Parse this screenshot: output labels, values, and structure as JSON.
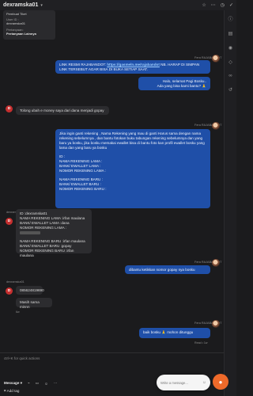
{
  "header": {
    "title": "dexramska01"
  },
  "info_card": {
    "top_text": "Pembuat Tiket",
    "user_id_label": "User ID :",
    "user_id_value": "dexramska01",
    "question_label": "Pertanyaan:",
    "question_value": "Pertanyaan Lainnya"
  },
  "messages": [
    {
      "id": "m1",
      "direction": "outgoing",
      "sender": "Fera RAJABANDOT",
      "text_before_link": "LINK RESMI RAJABANDOT: ",
      "link": "https://gasmeln.me/rajabandot",
      "text_after_link": " NB. HARAP DI SIMPAN LINK TERSEBUT AGAR BISA DI BUKA SETIAP SAAT."
    },
    {
      "id": "m2",
      "direction": "outgoing",
      "lines": [
        "Halo, selamat Pagi Bosku..",
        "Ada yang bisa kami bantu? 🙏"
      ]
    },
    {
      "id": "m3",
      "direction": "incoming",
      "avatar": "D",
      "text": "Tolong ubah e money saya dari dana menjadi gopay"
    },
    {
      "id": "m4",
      "direction": "outgoing",
      "sender": "Fera RAJABANDOT",
      "paragraph": "Jika ingin ganti rekening , Nama Rekening yang mau di ganti Harus sama dengan nama rekening sebelumnya , dan bantu fotokan buku tabungan rekening sebelumnya dan yang baru ya bosku, jika bosku memakai ewallet bisa di bantu foto kan profil ewallet bosku yang lama dan yang baru ya bosku",
      "lines": [
        "ID :",
        "NAMA REKENING LAMA :",
        "BANK/ EWALLET LAMA :",
        "NOMOR REKENING LAMA :",
        "",
        "NAMA REKENING BARU :",
        "BANK/ EWALLET BARU :",
        "NOMOR REKENING BARU :"
      ]
    },
    {
      "id": "m5",
      "direction": "incoming",
      "avatar": "D",
      "sender": "dexramska01",
      "lines": [
        "ID :dexramska01",
        "NAMA REKENING LAMA :irfan maulana",
        "BANK/ EWALLET LAMA :dana",
        "NOMOR REKENING LAMA :",
        "",
        "NAMA REKENING BARU :irfan maulana",
        "BANK/ EWALLET BARU :gopay",
        "NOMOR REKENING BARU :irfan maulana"
      ]
    },
    {
      "id": "m6",
      "direction": "outgoing",
      "sender": "Fera RAJABANDOT",
      "text": "dibantu ketikkan nomor gopay nya bosku"
    },
    {
      "id": "m7",
      "direction": "incoming",
      "avatar": "D",
      "sender": "dexramska01",
      "text": "085624819690"
    },
    {
      "id": "m8",
      "direction": "incoming",
      "text": "Masih sama minnn",
      "meta": "6w"
    },
    {
      "id": "m9",
      "direction": "outgoing",
      "sender": "Fera RAJABANDOT",
      "text": "baik bosku 🙏 mohon ditunggu",
      "status": "Read • 1w"
    }
  ],
  "composer": {
    "hint": "ctrl+K for quick actions",
    "tab_label": "Message",
    "send_label": "Send",
    "add_tag_label": "Add tag"
  },
  "widget": {
    "placeholder": "Write a message..."
  },
  "colors": {
    "outgoing": "#1f4fa8",
    "incoming": "#2c2c2f",
    "avatar": "#c62f2f",
    "launcher": "#ef6a2a"
  }
}
